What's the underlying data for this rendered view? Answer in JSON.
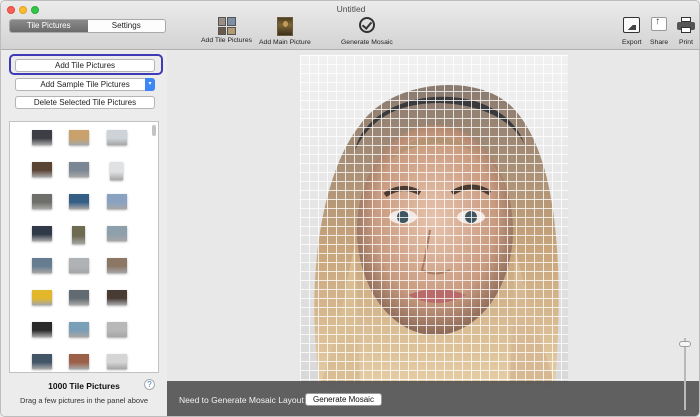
{
  "window": {
    "title": "Untitled"
  },
  "toolbar": {
    "tabs": [
      {
        "label": "Tile Pictures",
        "active": true
      },
      {
        "label": "Settings",
        "active": false
      }
    ],
    "add_tile_pictures": "Add Tile Pictures",
    "add_main_picture": "Add Main Picture",
    "generate_mosaic": "Generate Mosaic",
    "export": "Export",
    "share": "Share",
    "print": "Print"
  },
  "left_panel": {
    "add_tile_button": "Add Tile Pictures",
    "add_sample_popup": "Add Sample Tile Pictures",
    "delete_button": "Delete Selected Tile Pictures",
    "tile_count": "1000 Tile Pictures",
    "hint": "Drag a few pictures in the panel above",
    "help": "?",
    "tile_colors": [
      "#3d3d45",
      "#c9a26b",
      "#cdd3d8",
      "#5a4535",
      "#7b8794",
      "#dfe1e3",
      "#6e6f6a",
      "#355e85",
      "#8aa2c2",
      "#2f3947",
      "#6f6a52",
      "#8fa0ad",
      "#657c91",
      "#b0b3b6",
      "#8c7765",
      "#e3b72a",
      "#626b72",
      "#473b34",
      "#2a2a2a",
      "#7a9fb8",
      "#b8b8b8",
      "#425567",
      "#9c6048",
      "#d5d5d5"
    ]
  },
  "main": {
    "status_text": "Need to Generate Mosaic Layout",
    "generate_button": "Generate Mosaic",
    "zoom_level": 0.05
  }
}
